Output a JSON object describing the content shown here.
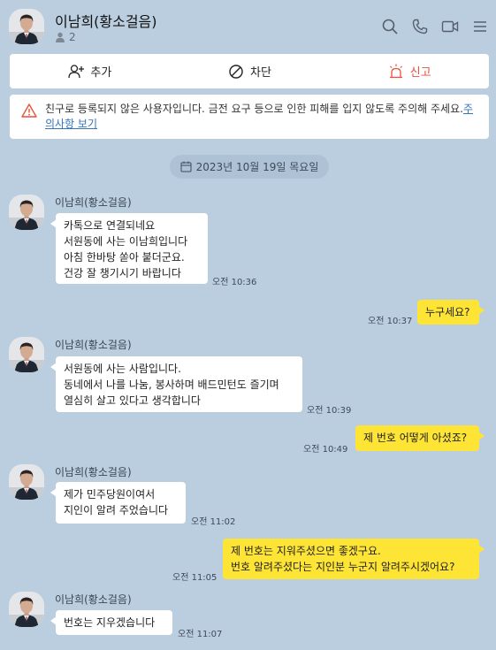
{
  "header": {
    "title": "이남희(황소걸음)",
    "member_count": "2",
    "icons": [
      "search-icon",
      "phone-icon",
      "video-icon",
      "menu-icon"
    ]
  },
  "actions": {
    "add_label": "추가",
    "block_label": "차단",
    "report_label": "신고"
  },
  "warning": {
    "text": "친구로 등록되지 않은 사용자입니다. 금전 요구 등으로 인한 피해를 입지 않도록 주의해 주세요.",
    "link": "주의사항 보기"
  },
  "date_divider": "2023년 10월 19일 목요일",
  "colors": {
    "background": "#bacee0",
    "my_bubble": "#fde435",
    "their_bubble": "#ffffff",
    "report_red": "#e8513c"
  },
  "messages": [
    {
      "sender": "이남희(황소걸음)",
      "text": "카톡으로 연결되네요\n서원동에 사는 이남희입니다\n아침 한바탕 쏟아 붙더군요.\n건강 잘 챙기시기 바랍니다",
      "time": "오전 10:36"
    },
    {
      "text": "누구세요?",
      "time": "오전 10:37"
    },
    {
      "sender": "이남희(황소걸음)",
      "text": "서원동에 사는 사람입니다.\n동네에서 나를 나눔, 봉사하며 배드민턴도 즐기며\n열심히 살고 있다고 생각합니다",
      "time": "오전 10:39"
    },
    {
      "text": "제 번호 어떻게 아셨죠?",
      "time": "오전 10:49"
    },
    {
      "sender": "이남희(황소걸음)",
      "text": "제가 민주당원이여서\n지인이 알려 주었습니다",
      "time": "오전 11:02"
    },
    {
      "text": "제 번호는 지워주셨으면 좋겠구요.\n번호 알려주셨다는 지인분 누군지 알려주시겠어요?",
      "time": "오전 11:05"
    },
    {
      "sender": "이남희(황소걸음)",
      "text": "번호는 지우겠습니다",
      "time": "오전 11:07"
    }
  ]
}
